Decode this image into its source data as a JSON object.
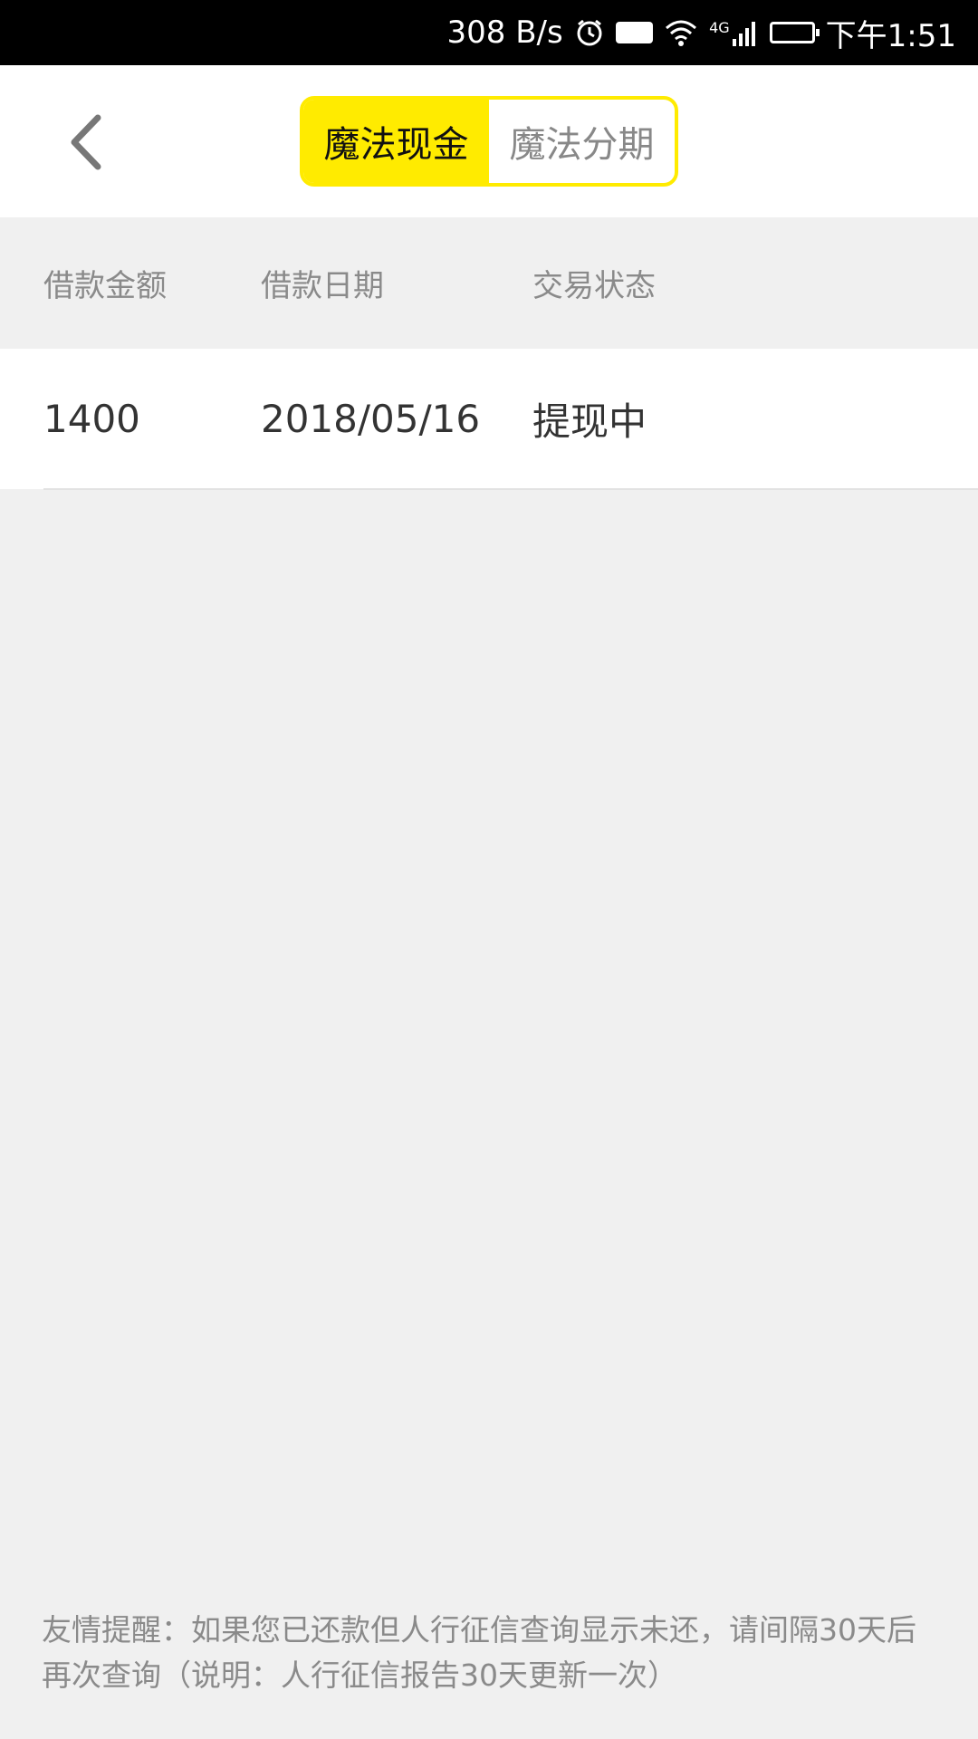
{
  "status_bar": {
    "speed": "308 B/s",
    "hd": "HD",
    "network": "4G",
    "time": "下午1:51",
    "icons": [
      "alarm-icon",
      "hd-icon",
      "wifi-icon",
      "signal-icon",
      "battery-icon"
    ]
  },
  "header": {
    "back_icon": "chevron-left-icon",
    "tabs": [
      {
        "label": "魔法现金",
        "active": true
      },
      {
        "label": "魔法分期",
        "active": false
      }
    ]
  },
  "table": {
    "columns": [
      "借款金额",
      "借款日期",
      "交易状态"
    ],
    "rows": [
      {
        "amount": "1400",
        "date": "2018/05/16",
        "status": "提现中"
      }
    ]
  },
  "notice": {
    "text": "友情提醒：如果您已还款但人行征信查询显示未还，请间隔30天后再次查询（说明：人行征信报告30天更新一次）"
  },
  "colors": {
    "accent": "#ffeb00",
    "background": "#f0f0f0",
    "muted_text": "#8a8a8a",
    "primary_text": "#333333"
  }
}
